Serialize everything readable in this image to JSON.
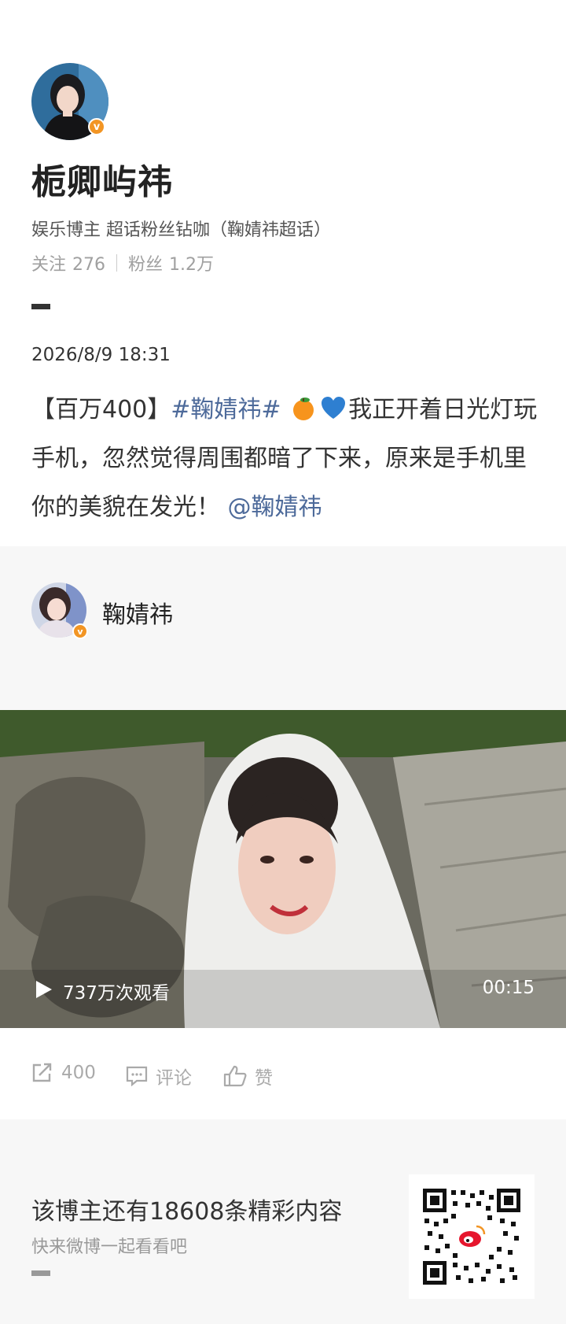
{
  "profile": {
    "avatar": "user-avatar",
    "verified_badge": "v",
    "nickname": "栀卿屿祎",
    "description": "娱乐博主 超话粉丝钻咖（鞠婧祎超话）",
    "following_label": "关注",
    "following_count": "276",
    "followers_label": "粉丝",
    "followers_count": "1.2万"
  },
  "post": {
    "time": "2026/8/9 18:31",
    "prefix": "【百万400】",
    "topic": "#鞠婧祎#",
    "emojis": [
      "orange-emoji",
      "blue-heart-emoji"
    ],
    "body": "我正开着日光灯玩手机，忽然觉得周围都暗了下来，原来是手机里你的美貌在发光！",
    "mention": "@鞠婧祎"
  },
  "retweet": {
    "author": "鞠婧祎",
    "verified_badge": "v",
    "video": {
      "views": "737万次观看",
      "duration": "00:15"
    }
  },
  "actions": {
    "repost_count": "400",
    "comment_label": "评论",
    "like_label": "赞"
  },
  "footer": {
    "title": "该博主还有18608条精彩内容",
    "subtitle": "快来微博一起看看吧",
    "qr": "weibo-qr-code"
  },
  "colors": {
    "link": "#4d6a9a",
    "badge": "#f29524",
    "panel_bg": "#f7f7f7"
  }
}
